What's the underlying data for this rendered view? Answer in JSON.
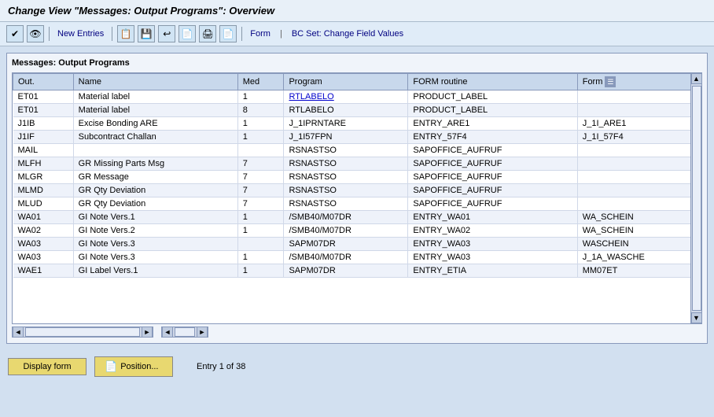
{
  "title": "Change View \"Messages: Output Programs\": Overview",
  "toolbar": {
    "buttons": [
      {
        "name": "activate",
        "icon": "✔",
        "label": ""
      },
      {
        "name": "display",
        "icon": "👁",
        "label": ""
      },
      {
        "name": "new-entries",
        "label": "New Entries"
      },
      {
        "name": "copy-icon",
        "icon": "📋"
      },
      {
        "name": "save-icon",
        "icon": "💾"
      },
      {
        "name": "undo-icon",
        "icon": "↩"
      },
      {
        "name": "redo-icon",
        "icon": "📄"
      },
      {
        "name": "print-icon",
        "icon": "🖨"
      },
      {
        "name": "pdf-icon",
        "icon": "📄"
      },
      {
        "name": "form-label",
        "label": "Form"
      },
      {
        "name": "bc-set-label",
        "label": "BC Set: Change Field Values"
      }
    ]
  },
  "panel": {
    "title": "Messages: Output Programs"
  },
  "table": {
    "columns": [
      {
        "key": "out",
        "label": "Out."
      },
      {
        "key": "name",
        "label": "Name"
      },
      {
        "key": "med",
        "label": "Med"
      },
      {
        "key": "program",
        "label": "Program"
      },
      {
        "key": "form_routine",
        "label": "FORM routine"
      },
      {
        "key": "form",
        "label": "Form"
      }
    ],
    "rows": [
      {
        "out": "ET01",
        "name": "Material label",
        "med": "1",
        "program": "RTLABELO",
        "form_routine": "PRODUCT_LABEL",
        "form": "",
        "program_link": true
      },
      {
        "out": "ET01",
        "name": "Material label",
        "med": "8",
        "program": "RTLABELO",
        "form_routine": "PRODUCT_LABEL",
        "form": ""
      },
      {
        "out": "J1IB",
        "name": "Excise Bonding ARE",
        "med": "1",
        "program": "J_1IPRNTARE",
        "form_routine": "ENTRY_ARE1",
        "form": "J_1I_ARE1"
      },
      {
        "out": "J1IF",
        "name": "Subcontract Challan",
        "med": "1",
        "program": "J_1I57FPN",
        "form_routine": "ENTRY_57F4",
        "form": "J_1I_57F4"
      },
      {
        "out": "MAIL",
        "name": "",
        "med": "",
        "program": "RSNASTSO",
        "form_routine": "SAPOFFICE_AUFRUF",
        "form": ""
      },
      {
        "out": "MLFH",
        "name": "GR Missing Parts Msg",
        "med": "7",
        "program": "RSNASTSO",
        "form_routine": "SAPOFFICE_AUFRUF",
        "form": ""
      },
      {
        "out": "MLGR",
        "name": "GR Message",
        "med": "7",
        "program": "RSNASTSO",
        "form_routine": "SAPOFFICE_AUFRUF",
        "form": ""
      },
      {
        "out": "MLMD",
        "name": "GR Qty Deviation",
        "med": "7",
        "program": "RSNASTSO",
        "form_routine": "SAPOFFICE_AUFRUF",
        "form": ""
      },
      {
        "out": "MLUD",
        "name": "GR Qty Deviation",
        "med": "7",
        "program": "RSNASTSO",
        "form_routine": "SAPOFFICE_AUFRUF",
        "form": ""
      },
      {
        "out": "WA01",
        "name": "GI Note Vers.1",
        "med": "1",
        "program": "/SMB40/M07DR",
        "form_routine": "ENTRY_WA01",
        "form": "WA_SCHEIN"
      },
      {
        "out": "WA02",
        "name": "GI Note Vers.2",
        "med": "1",
        "program": "/SMB40/M07DR",
        "form_routine": "ENTRY_WA02",
        "form": "WA_SCHEIN"
      },
      {
        "out": "WA03",
        "name": "GI Note Vers.3",
        "med": "",
        "program": "SAPM07DR",
        "form_routine": "ENTRY_WA03",
        "form": "WASCHEIN"
      },
      {
        "out": "WA03",
        "name": "GI Note Vers.3",
        "med": "1",
        "program": "/SMB40/M07DR",
        "form_routine": "ENTRY_WA03",
        "form": "J_1A_WASCHE"
      },
      {
        "out": "WAE1",
        "name": "GI Label Vers.1",
        "med": "1",
        "program": "SAPM07DR",
        "form_routine": "ENTRY_ETIA",
        "form": "MM07ET"
      }
    ]
  },
  "footer": {
    "display_form_label": "Display form",
    "position_label": "Position...",
    "entry_count": "Entry 1 of 38"
  }
}
